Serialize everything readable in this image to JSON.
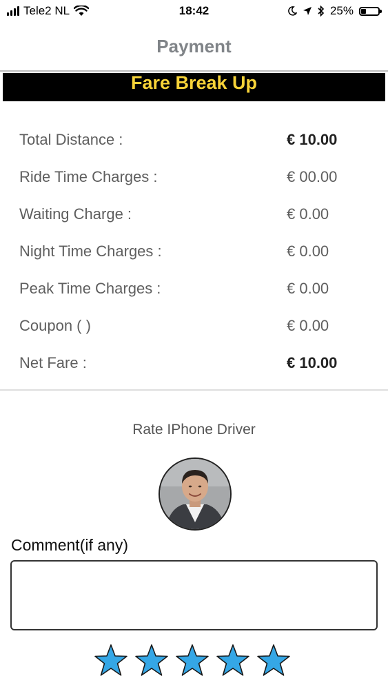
{
  "status_bar": {
    "carrier": "Tele2 NL",
    "time": "18:42",
    "battery": "25%",
    "battery_level": 0.25,
    "icons": [
      "signal-icon",
      "wifi-icon",
      "moon-icon",
      "location-arrow-icon",
      "bluetooth-icon",
      "battery-icon"
    ]
  },
  "nav": {
    "title": "Payment"
  },
  "fare": {
    "banner": "Fare Break Up",
    "rows": [
      {
        "label": "Total Distance :",
        "value": "€ 10.00"
      },
      {
        "label": "Ride Time Charges :",
        "value": "€ 00.00"
      },
      {
        "label": "Waiting Charge :",
        "value": "€ 0.00"
      },
      {
        "label": "Night Time Charges :",
        "value": "€ 0.00"
      },
      {
        "label": "Peak Time Charges :",
        "value": "€ 0.00"
      },
      {
        "label": "Coupon ( )",
        "value": "€ 0.00"
      },
      {
        "label": "Net Fare :",
        "value": "€ 10.00"
      }
    ]
  },
  "rating": {
    "title": "Rate IPhone Driver",
    "comment_label": "Comment(if any)",
    "comment_value": "",
    "stars": 5,
    "star_color": "#35a7e6"
  },
  "colors": {
    "banner_bg": "#000000",
    "banner_text": "#f7d338"
  }
}
